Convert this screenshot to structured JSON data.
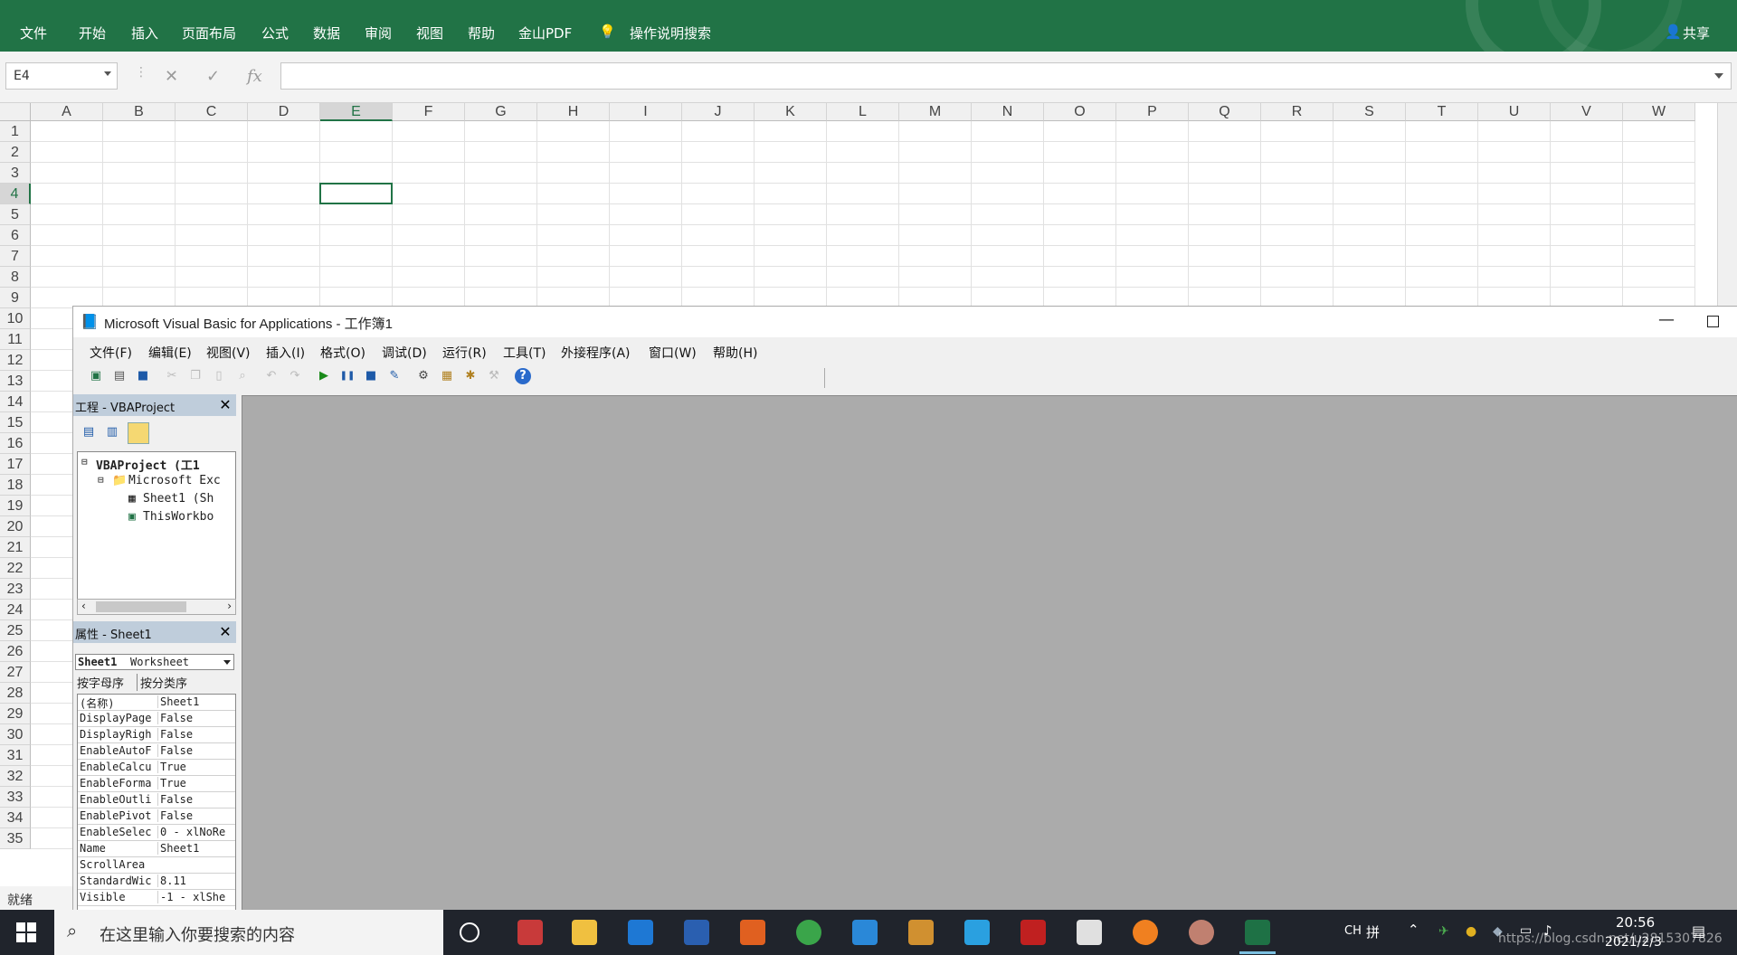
{
  "ribbon": {
    "tabs": [
      "文件",
      "开始",
      "插入",
      "页面布局",
      "公式",
      "数据",
      "审阅",
      "视图",
      "帮助",
      "金山PDF"
    ],
    "search_label": "操作说明搜索",
    "share_label": "共享"
  },
  "formula_bar": {
    "name_box": "E4",
    "cancel_icon": "✕",
    "enter_icon": "✓",
    "fx_label": "fx",
    "content": ""
  },
  "sheet": {
    "columns": [
      "A",
      "B",
      "C",
      "D",
      "E",
      "F",
      "G",
      "H",
      "I",
      "J",
      "K",
      "L",
      "M",
      "N",
      "O",
      "P",
      "Q",
      "R",
      "S",
      "T",
      "U",
      "V",
      "W"
    ],
    "rows": [
      "1",
      "2",
      "3",
      "4",
      "5",
      "6",
      "7",
      "8",
      "9",
      "10",
      "11",
      "12",
      "13",
      "14",
      "15",
      "16",
      "17",
      "18",
      "19",
      "20",
      "21",
      "22",
      "23",
      "24",
      "25",
      "26",
      "27",
      "28",
      "29",
      "30",
      "31",
      "32",
      "33",
      "34",
      "35"
    ],
    "selected_cell": "E4"
  },
  "status": {
    "text": "就绪"
  },
  "vba": {
    "title": "Microsoft Visual Basic for Applications - 工作簿1",
    "menu": [
      "文件(F)",
      "编辑(E)",
      "视图(V)",
      "插入(I)",
      "格式(O)",
      "调试(D)",
      "运行(R)",
      "工具(T)",
      "外接程序(A)",
      "窗口(W)",
      "帮助(H)"
    ],
    "project_pane": {
      "title": "工程 - VBAProject",
      "tree": [
        "VBAProject (工1",
        "Microsoft Exc",
        "Sheet1 (Sh",
        "ThisWorkbo"
      ]
    },
    "properties_pane": {
      "title": "属性 - Sheet1",
      "object_name": "Sheet1",
      "object_type": "Worksheet",
      "tabs": [
        "按字母序",
        "按分类序"
      ],
      "rows": [
        {
          "name": "(名称)",
          "value": "Sheet1"
        },
        {
          "name": "DisplayPage",
          "value": "False"
        },
        {
          "name": "DisplayRigh",
          "value": "False"
        },
        {
          "name": "EnableAutoF",
          "value": "False"
        },
        {
          "name": "EnableCalcu",
          "value": "True"
        },
        {
          "name": "EnableForma",
          "value": "True"
        },
        {
          "name": "EnableOutli",
          "value": "False"
        },
        {
          "name": "EnablePivot",
          "value": "False"
        },
        {
          "name": "EnableSelec",
          "value": "0 - xlNoRe"
        },
        {
          "name": "Name",
          "value": "Sheet1"
        },
        {
          "name": "ScrollArea",
          "value": ""
        },
        {
          "name": "StandardWic",
          "value": "8.11"
        },
        {
          "name": "Visible",
          "value": "-1 - xlShe"
        }
      ]
    }
  },
  "taskbar": {
    "search_placeholder": "在这里输入你要搜索的内容",
    "lang": "CH",
    "ime": "拼",
    "time": "20:56",
    "date": "2021/2/3",
    "watermark": "https://blog.csdn.net/u2815307826"
  }
}
